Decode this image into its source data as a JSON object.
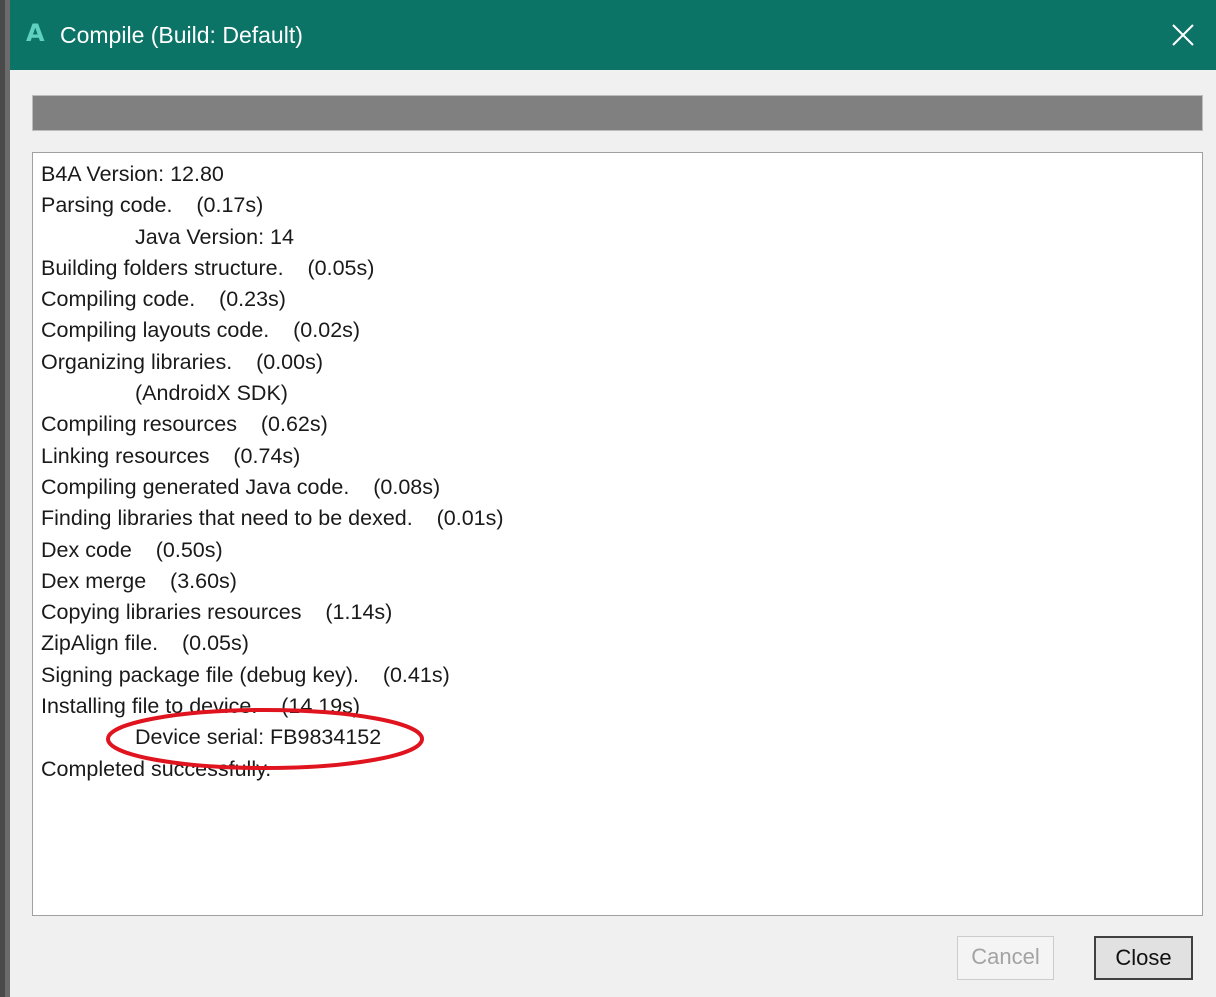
{
  "window": {
    "title": "Compile (Build: Default)",
    "app_icon_glyph": "A",
    "app_icon": "b4a-app-icon",
    "close_icon": "close-x-icon"
  },
  "progress": {
    "fill_fraction": 1.0
  },
  "log": {
    "lines": [
      {
        "text": "B4A Version: 12.80",
        "indent": false
      },
      {
        "text": "Parsing code.    (0.17s)",
        "indent": false
      },
      {
        "text": "Java Version: 14",
        "indent": true
      },
      {
        "text": "Building folders structure.    (0.05s)",
        "indent": false
      },
      {
        "text": "Compiling code.    (0.23s)",
        "indent": false
      },
      {
        "text": "Compiling layouts code.    (0.02s)",
        "indent": false
      },
      {
        "text": "Organizing libraries.    (0.00s)",
        "indent": false
      },
      {
        "text": "(AndroidX SDK)",
        "indent": true
      },
      {
        "text": "Compiling resources    (0.62s)",
        "indent": false
      },
      {
        "text": "Linking resources    (0.74s)",
        "indent": false
      },
      {
        "text": "Compiling generated Java code.    (0.08s)",
        "indent": false
      },
      {
        "text": "Finding libraries that need to be dexed.    (0.01s)",
        "indent": false
      },
      {
        "text": "Dex code    (0.50s)",
        "indent": false
      },
      {
        "text": "Dex merge    (3.60s)",
        "indent": false
      },
      {
        "text": "Copying libraries resources    (1.14s)",
        "indent": false
      },
      {
        "text": "ZipAlign file.    (0.05s)",
        "indent": false
      },
      {
        "text": "Signing package file (debug key).    (0.41s)",
        "indent": false
      },
      {
        "text": "Installing file to device.    (14.19s)",
        "indent": false
      },
      {
        "text": "Device serial: FB9834152",
        "indent": true
      },
      {
        "text": "Completed successfully.",
        "indent": false
      }
    ]
  },
  "annotation": {
    "shape": "ellipse",
    "color": "#e0141e",
    "highlights": "Device serial: FB9834152"
  },
  "buttons": {
    "cancel_label": "Cancel",
    "cancel_enabled": false,
    "close_label": "Close"
  },
  "colors": {
    "titlebar": "#0b7466",
    "progress_fill": "#808080",
    "annotation": "#e0141e"
  }
}
